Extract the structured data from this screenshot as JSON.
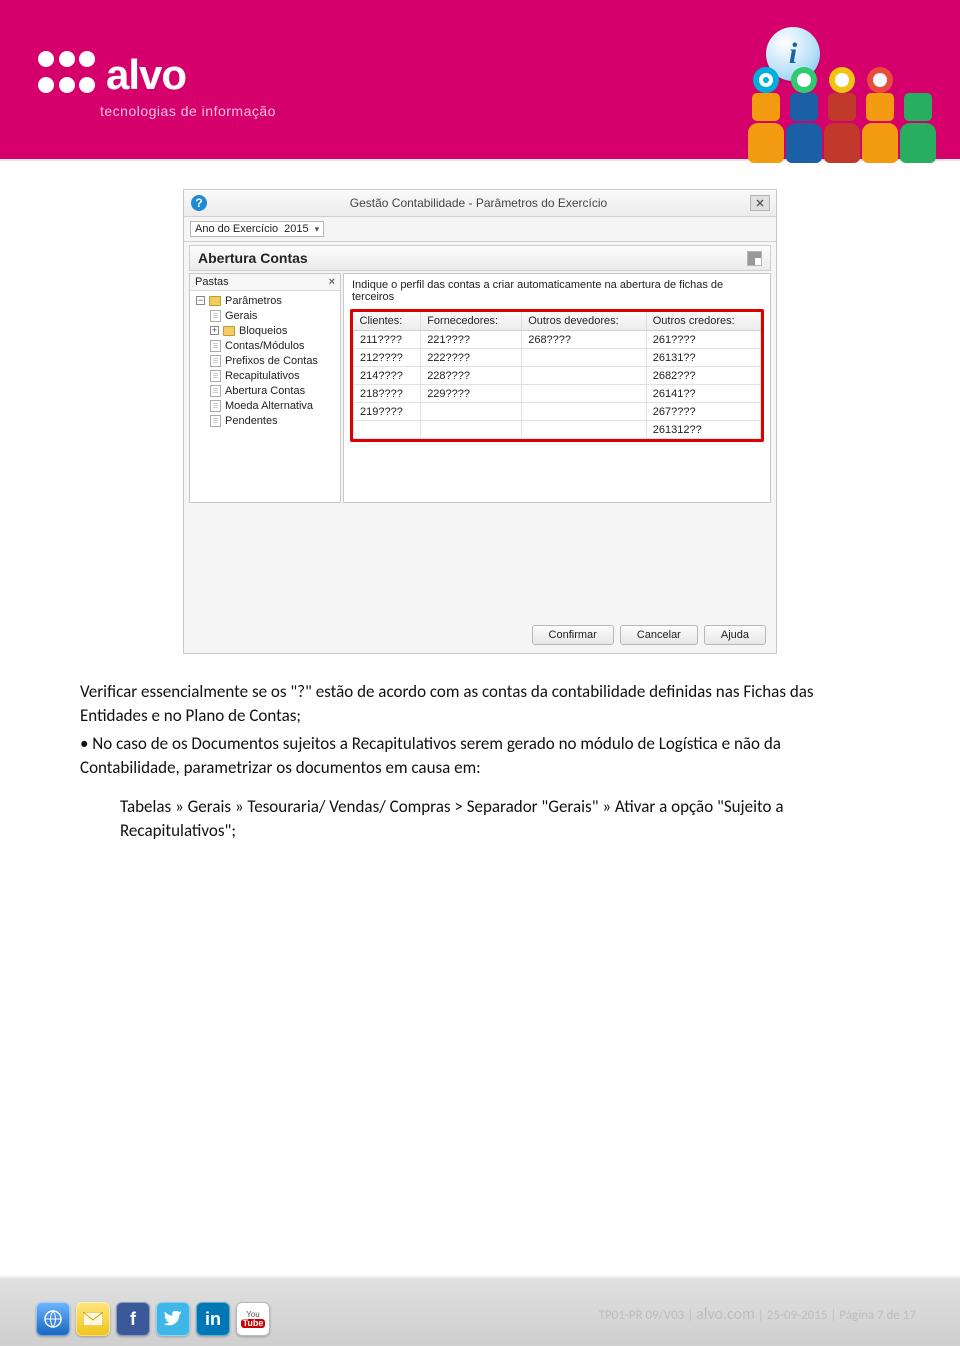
{
  "banner": {
    "brand": "alvo",
    "tagline": "tecnologias de informação",
    "info_glyph": "i"
  },
  "screenshot": {
    "title": "Gestão Contabilidade - Parâmetros do Exercício",
    "help_glyph": "?",
    "close_glyph": "×",
    "year_label": "Ano do Exercício",
    "year_value": "2015",
    "section_title": "Abertura Contas",
    "tree_header": "Pastas",
    "tree_close": "×",
    "tree": {
      "root": "Parâmetros",
      "items": [
        "Gerais",
        "Bloqueios",
        "Contas/Módulos",
        "Prefixos de Contas",
        "Recapitulativos",
        "Abertura Contas",
        "Moeda Alternativa",
        "Pendentes"
      ]
    },
    "table": {
      "instruction": "Indique o perfil das contas a criar automaticamente na abertura de fichas de terceiros",
      "headers": [
        "Clientes:",
        "Fornecedores:",
        "Outros devedores:",
        "Outros credores:"
      ],
      "rows": [
        [
          "211????",
          "221????",
          "268????",
          "261????"
        ],
        [
          "212????",
          "222????",
          "",
          "26131??"
        ],
        [
          "214????",
          "228????",
          "",
          "2682???"
        ],
        [
          "218????",
          "229????",
          "",
          "26141??"
        ],
        [
          "219????",
          "",
          "",
          "267????"
        ],
        [
          "",
          "",
          "",
          "261312??"
        ]
      ]
    },
    "buttons": {
      "confirm": "Confirmar",
      "cancel": "Cancelar",
      "help": "Ajuda"
    }
  },
  "body": {
    "p1": "Verificar essencialmente se os \"?\" estão de acordo com as contas da contabilidade definidas nas Fichas das Entidades e no Plano de Contas;",
    "p2": "• No caso de os Documentos sujeitos a Recapitulativos serem gerado no módulo de Logística e não da Contabilidade, parametrizar os documentos em causa em:",
    "p3": "Tabelas » Gerais » Tesouraria/ Vendas/ Compras > Separador \"Gerais\" » Ativar a opção \"Sujeito a Recapitulativos\";"
  },
  "footer": {
    "text_prefix": "TP01-PR 09/V03 | ",
    "domain": "alvo.com",
    "text_suffix": " | 25-09-2015 | Página 7 de 17"
  }
}
